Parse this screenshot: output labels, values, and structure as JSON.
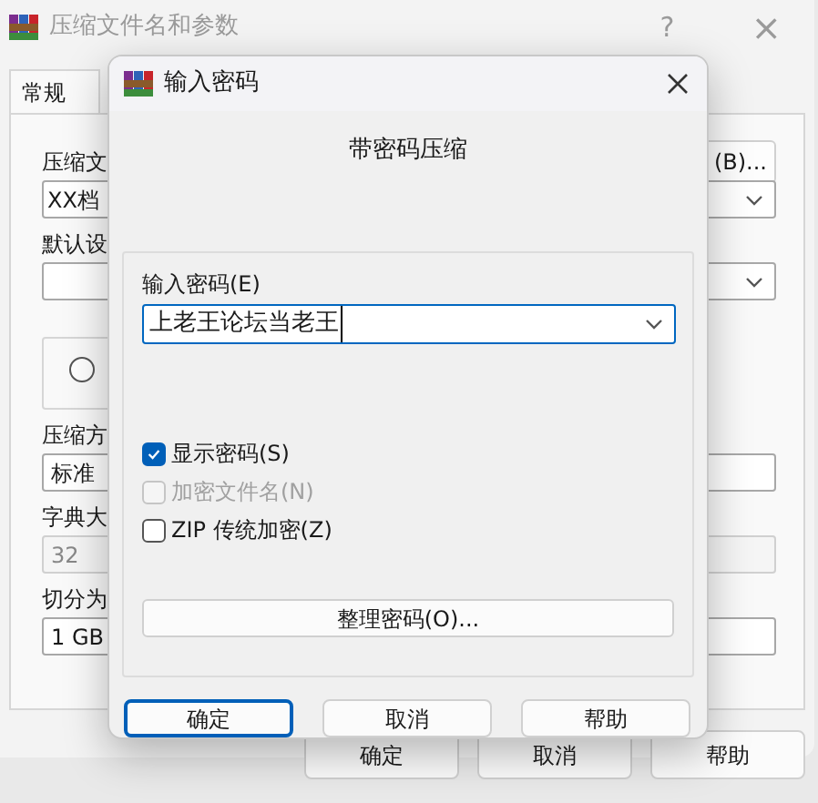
{
  "main_window": {
    "title": "压缩文件名和参数",
    "help": "?",
    "close": "×",
    "tabs": [
      {
        "label": "常规",
        "selected": true
      }
    ],
    "browse_button": "(B)...",
    "controls": [
      {
        "kind": "label",
        "text": "压缩文"
      },
      {
        "kind": "combo",
        "value": "XX档"
      },
      {
        "kind": "label",
        "text": "默认设"
      },
      {
        "kind": "combo"
      },
      {
        "kind": "group",
        "selected": false
      },
      {
        "kind": "label",
        "text": "压缩方"
      },
      {
        "kind": "field",
        "value": "标准",
        "disabled": false
      },
      {
        "kind": "label",
        "text": "字典大"
      },
      {
        "kind": "field",
        "value": "32",
        "disabled": true
      },
      {
        "kind": "label",
        "text": "切分为"
      },
      {
        "kind": "field",
        "value": "1 GB",
        "disabled": false
      }
    ],
    "buttons": [
      {
        "label": "确定",
        "default": false
      },
      {
        "label": "取消",
        "default": false
      },
      {
        "label": "帮助",
        "default": false
      }
    ]
  },
  "password_dialog": {
    "title": "输入密码",
    "heading": "带密码压缩",
    "password_label": "输入密码(E)",
    "password_value": "上老王论坛当老王",
    "options": [
      {
        "label": "显示密码(S)",
        "checked": true,
        "disabled": false
      },
      {
        "label": "加密文件名(N)",
        "checked": false,
        "disabled": true
      },
      {
        "label": "ZIP 传统加密(Z)",
        "checked": false,
        "disabled": false
      }
    ],
    "organize_button": "整理密码(O)...",
    "buttons": [
      {
        "label": "确定",
        "default": true
      },
      {
        "label": "取消",
        "default": false
      },
      {
        "label": "帮助",
        "default": false
      }
    ]
  }
}
